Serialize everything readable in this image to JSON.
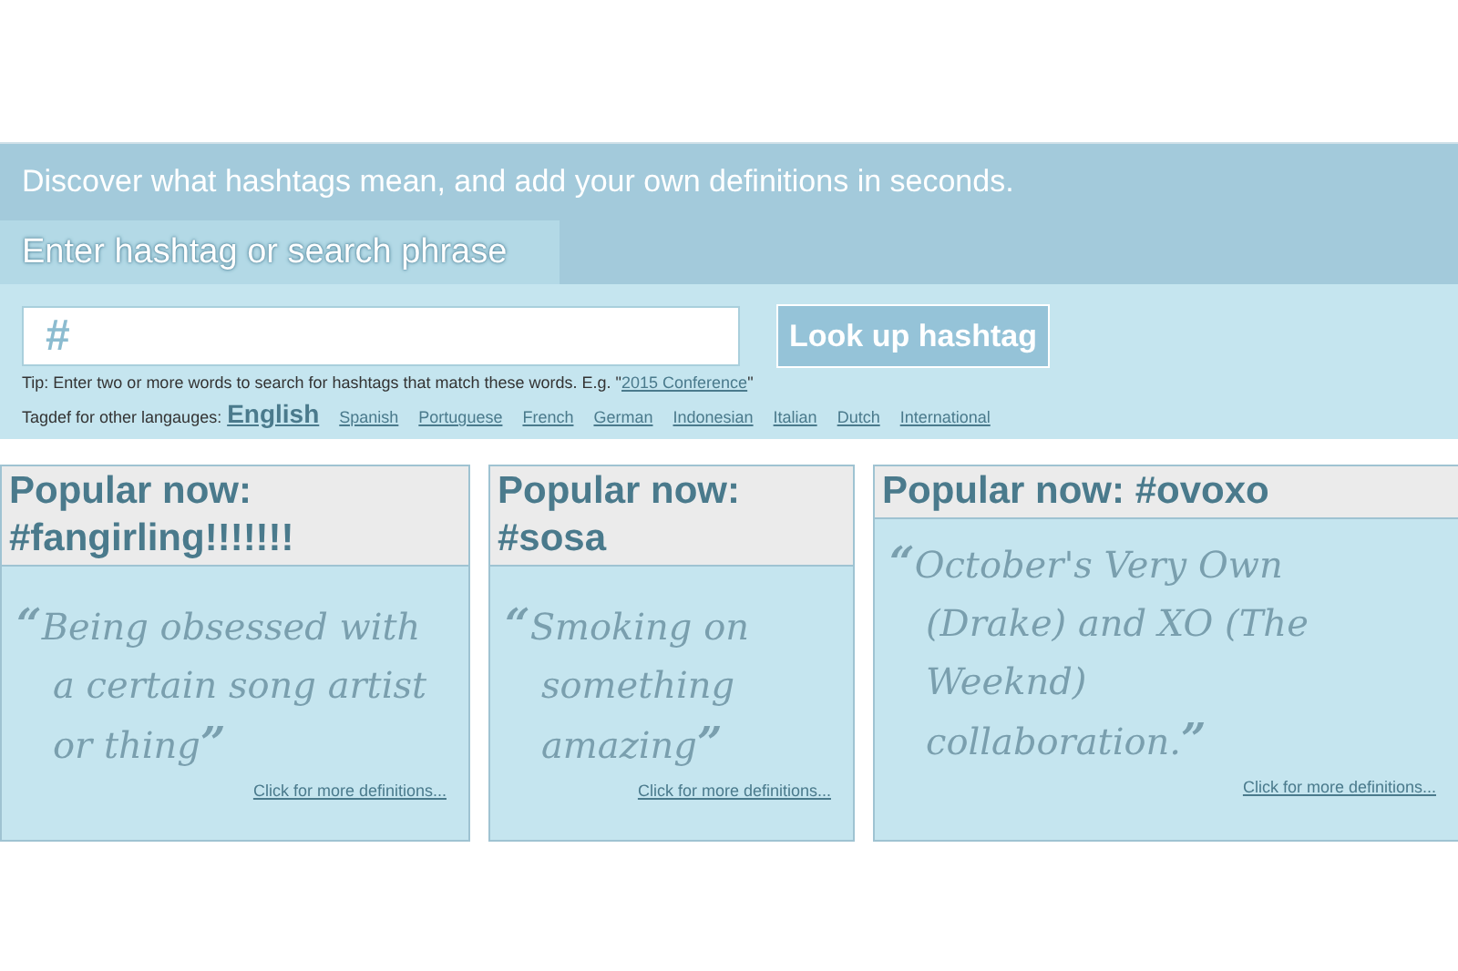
{
  "banner": {
    "text": "Discover what hashtags mean, and add your own definitions in seconds."
  },
  "search_tab": {
    "label": "Enter hashtag or search phrase"
  },
  "search": {
    "value": "#",
    "button": "Look up hashtag"
  },
  "tip": {
    "before": "Tip: Enter two or more words to search for hashtags that match these words. E.g. \"",
    "link": "2015 Conference",
    "after": "\""
  },
  "languages": {
    "label": "Tagdef for other langauges:",
    "items": [
      {
        "label": "English",
        "selected": true
      },
      {
        "label": "Spanish",
        "selected": false
      },
      {
        "label": "Portuguese",
        "selected": false
      },
      {
        "label": "French",
        "selected": false
      },
      {
        "label": "German",
        "selected": false
      },
      {
        "label": "Indonesian",
        "selected": false
      },
      {
        "label": "Italian",
        "selected": false
      },
      {
        "label": "Dutch",
        "selected": false
      },
      {
        "label": "International",
        "selected": false
      }
    ]
  },
  "cards": [
    {
      "title": "Popular now: #fangirling!!!!!!!",
      "open_quote": "“",
      "definition": "Being obsessed with a certain song artist or thing",
      "close_quote": "”",
      "link": "Click for more definitions..."
    },
    {
      "title": "Popular now: #sosa",
      "open_quote": "“",
      "definition": "Smoking on something amazing",
      "close_quote": "”",
      "link": "Click for more definitions..."
    },
    {
      "title": "Popular now: #ovoxo",
      "open_quote": "“",
      "definition": "October's Very Own (Drake) and XO (The Weeknd) collaboration.",
      "close_quote": "”",
      "link": "Click for more definitions..."
    }
  ]
}
